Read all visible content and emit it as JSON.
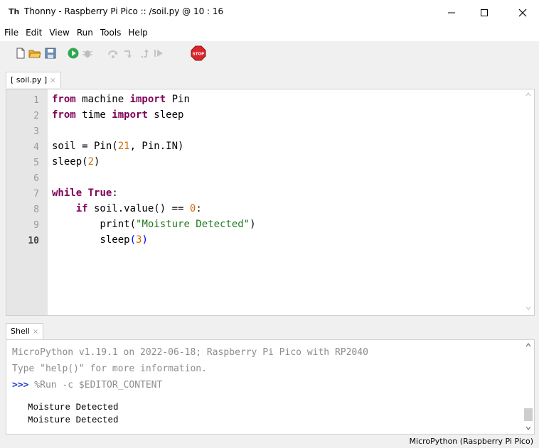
{
  "window": {
    "app_icon": "Th",
    "title": "Thonny  -  Raspberry Pi Pico :: /soil.py  @  10 : 16"
  },
  "menu": [
    "File",
    "Edit",
    "View",
    "Run",
    "Tools",
    "Help"
  ],
  "toolbar": {
    "icons": [
      "new-file-icon",
      "open-folder-icon",
      "save-icon",
      "run-icon",
      "debug-icon",
      "step-over-icon",
      "step-into-icon",
      "step-out-icon",
      "resume-icon",
      "stop-icon"
    ],
    "stop_label": "STOP"
  },
  "editor": {
    "tab_label": "[ soil.py ]",
    "tab_close": "×",
    "line_numbers": [
      "1",
      "2",
      "3",
      "4",
      "5",
      "6",
      "7",
      "8",
      "9",
      "10"
    ],
    "current_line": "10",
    "code": {
      "l1": {
        "kw1": "from",
        "t1": " machine ",
        "kw2": "import",
        "t2": " Pin"
      },
      "l2": {
        "kw1": "from",
        "t1": " time ",
        "kw2": "import",
        "t2": " sleep"
      },
      "l4": {
        "t1": "soil = Pin(",
        "n1": "21",
        "t2": ", Pin.IN)"
      },
      "l5": {
        "t1": "sleep(",
        "n1": "2",
        "t2": ")"
      },
      "l7": {
        "kw1": "while",
        "t1": " ",
        "kw2": "True",
        "t2": ":"
      },
      "l8": {
        "indent": "    ",
        "kw1": "if",
        "t1": " soil.value() == ",
        "n1": "0",
        "t2": ":"
      },
      "l9": {
        "indent": "        ",
        "t1": "print(",
        "s1": "\"Moisture Detected\"",
        "t2": ")"
      },
      "l10": {
        "indent": "        ",
        "t1": "sleep",
        "p1": "(",
        "n1": "3",
        "p2": ")"
      }
    }
  },
  "shell": {
    "tab_label": "Shell",
    "tab_close": "×",
    "banner1": "MicroPython v1.19.1 on 2022-06-18; Raspberry Pi Pico with RP2040",
    "banner2": "Type \"help()\" for more information.",
    "prompt": ">>>",
    "command": " %Run -c $EDITOR_CONTENT",
    "output": [
      "Moisture Detected",
      "Moisture Detected"
    ]
  },
  "status": {
    "interpreter": "MicroPython (Raspberry Pi Pico)"
  }
}
